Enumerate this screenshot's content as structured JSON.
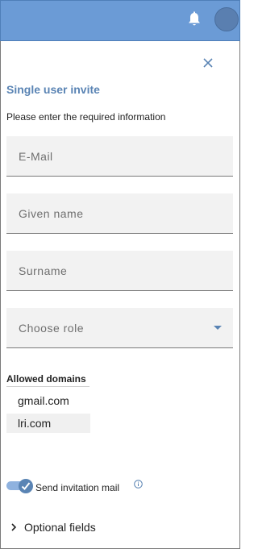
{
  "header": {
    "bell_icon": "bell-icon",
    "avatar": "user-avatar"
  },
  "dialog": {
    "close_icon": "close-icon",
    "title": "Single user invite",
    "subtitle": "Please enter the required information",
    "fields": {
      "email_placeholder": "E-Mail",
      "given_name_placeholder": "Given name",
      "surname_placeholder": "Surname",
      "role_placeholder": "Choose role"
    },
    "allowed_domains": {
      "label": "Allowed domains",
      "items": [
        "gmail.com",
        "lri.com"
      ]
    },
    "send_invitation": {
      "label": "Send invitation mail",
      "checked": true
    },
    "optional_fields": {
      "label": "Optional fields"
    }
  },
  "colors": {
    "header_bg": "#6b9bd6",
    "accent": "#5a84b4"
  }
}
